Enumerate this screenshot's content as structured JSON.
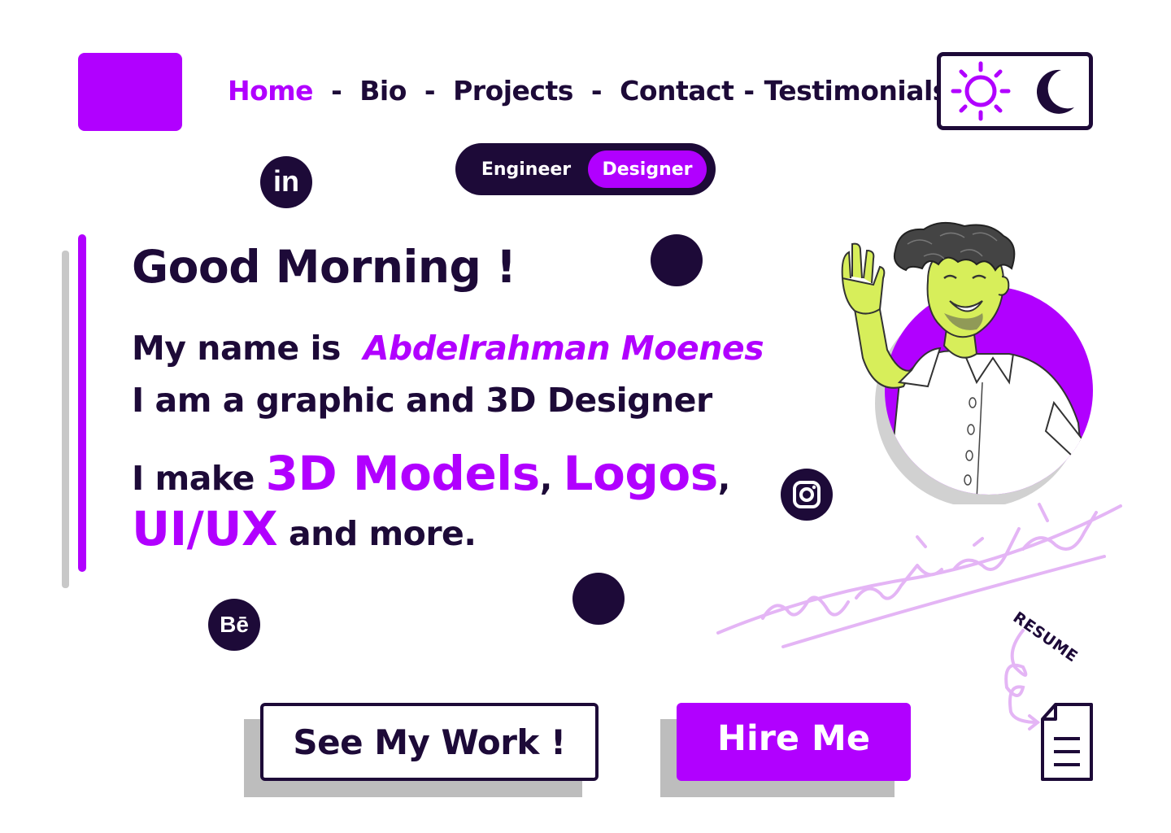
{
  "nav": {
    "items": [
      {
        "label": "Home",
        "active": true
      },
      {
        "label": "Bio"
      },
      {
        "label": "Projects"
      },
      {
        "label": "Contact"
      },
      {
        "label": "Testimonials"
      }
    ],
    "separator": "-"
  },
  "theme_toggle": {
    "icons": [
      "sun-icon",
      "moon-icon"
    ]
  },
  "role_switch": {
    "options": [
      "Engineer",
      "Designer"
    ],
    "selected": "Designer"
  },
  "social": {
    "icons": [
      "linkedin-icon",
      "instagram-icon",
      "behance-icon"
    ],
    "linkedin_text": "in",
    "behance_text": "Bē"
  },
  "hero": {
    "greeting": "Good Morning !",
    "name_prefix": "My name is",
    "name": "Abdelrahman Moenes",
    "role": "I am a graphic and 3D Designer",
    "make_prefix": "I make",
    "skill_1": "3D Models",
    "comma": ",",
    "skill_2": "Logos",
    "skill_3": "UI/UX",
    "make_suffix": "and more."
  },
  "buttons": {
    "see_work": "See My Work !",
    "hire_me": "Hire Me"
  },
  "resume": {
    "label": "RESUME"
  },
  "colors": {
    "accent": "#b100ff",
    "dark": "#1d0a38",
    "signature": "#e4b5f5",
    "shadow": "#bdbdbd"
  }
}
